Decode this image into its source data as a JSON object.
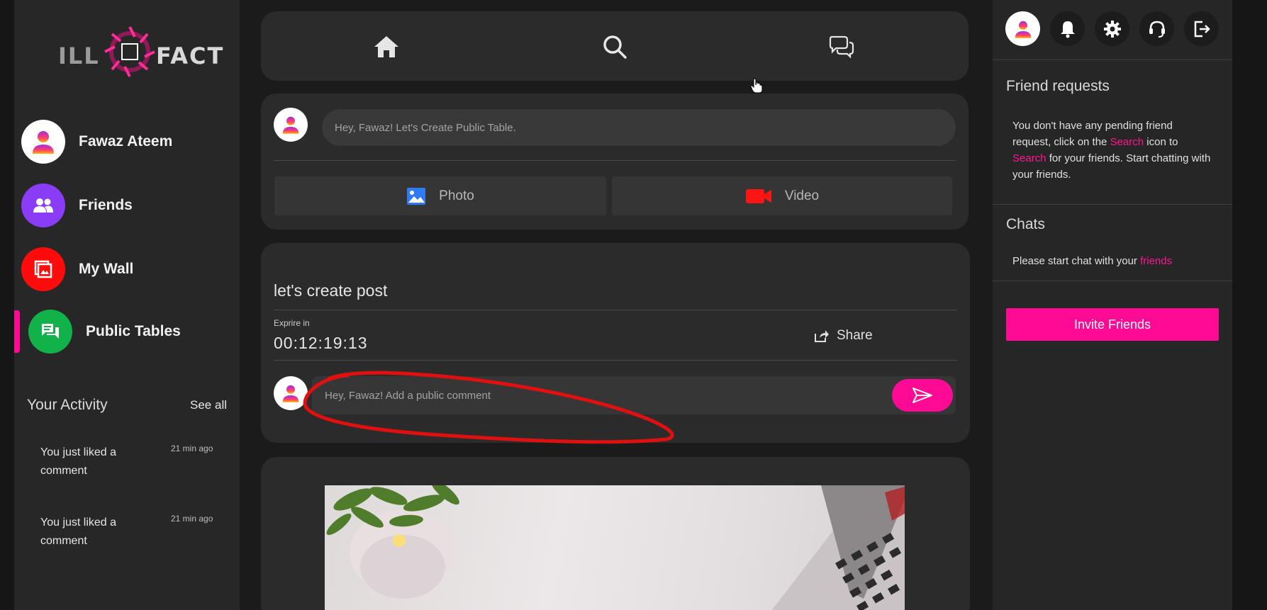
{
  "brand": {
    "logo_left": "ILL",
    "logo_right": "FACT"
  },
  "sidebar": {
    "items": [
      {
        "label": "Fawaz Ateem",
        "icon": "user-avatar-icon",
        "color": "#ffffff"
      },
      {
        "label": "Friends",
        "icon": "friends-icon",
        "color": "#8b3cf7"
      },
      {
        "label": "My Wall",
        "icon": "wall-icon",
        "color": "#ff0b0b"
      },
      {
        "label": "Public Tables",
        "icon": "chat-bubbles-icon",
        "color": "#12b24b",
        "active": true
      }
    ],
    "activity": {
      "title": "Your Activity",
      "see_all": "See all",
      "items": [
        {
          "text": "You just liked a comment",
          "time": "21 min ago"
        },
        {
          "text": "You just liked a comment",
          "time": "21 min ago"
        }
      ]
    }
  },
  "topnav": {
    "icons": [
      "home-icon",
      "search-icon",
      "chats-icon"
    ]
  },
  "composer": {
    "placeholder": "Hey, Fawaz! Let's Create Public Table.",
    "photo_label": "Photo",
    "video_label": "Video"
  },
  "post": {
    "title": "let's create post",
    "expire_label": "Exprire in",
    "expire_time": "00:12:19:13",
    "share_label": "Share",
    "comment_placeholder": "Hey, Fawaz! Add a public comment"
  },
  "rightpanel": {
    "icons": [
      "user-avatar-icon",
      "bell-icon",
      "gear-icon",
      "support-headset-icon",
      "logout-icon"
    ],
    "friend_requests": {
      "title": "Friend requests",
      "text_1": "You don't have any pending friend request, click on the",
      "search_link_1": "Search",
      "text_2": "icon to",
      "search_link_2": "Search",
      "text_3": "for your friends. Start chatting with your friends."
    },
    "chats": {
      "title": "Chats",
      "text": "Please start chat with your",
      "friends_link": "friends"
    },
    "invite_label": "Invite Friends"
  },
  "colors": {
    "accent": "#ff0a94",
    "bg": "#1b1b1c",
    "card": "#2b2b2c",
    "annotation": "#e01010"
  }
}
